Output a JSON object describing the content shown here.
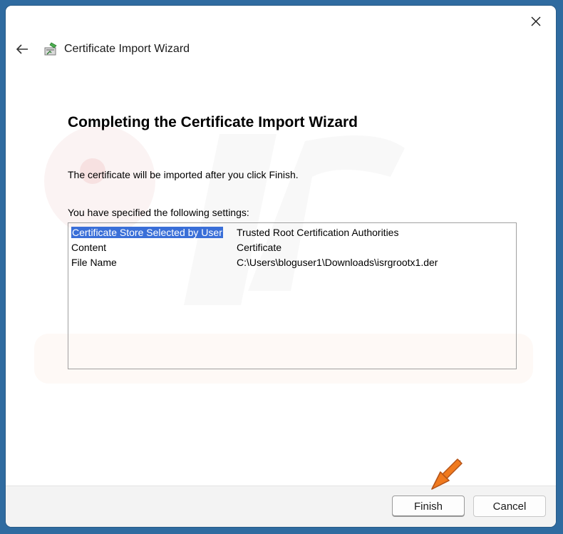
{
  "window": {
    "title": "Certificate Import Wizard",
    "icons": {
      "close": "close-icon",
      "back": "back-arrow-icon",
      "app": "certificate-wizard-icon"
    }
  },
  "content": {
    "heading": "Completing the Certificate Import Wizard",
    "info": "The certificate will be imported after you click Finish.",
    "settings_label": "You have specified the following settings:",
    "settings": [
      {
        "key": "Certificate Store Selected by User",
        "value": "Trusted Root Certification Authorities",
        "selected": true
      },
      {
        "key": "Content",
        "value": "Certificate",
        "selected": false
      },
      {
        "key": "File Name",
        "value": "C:\\Users\\bloguser1\\Downloads\\isrgrootx1.der",
        "selected": false
      }
    ]
  },
  "buttons": {
    "finish": "Finish",
    "cancel": "Cancel"
  },
  "colors": {
    "selection": "#3a6fd8",
    "annotation_arrow": "#f07a1e",
    "background": "#2f6ba0"
  }
}
